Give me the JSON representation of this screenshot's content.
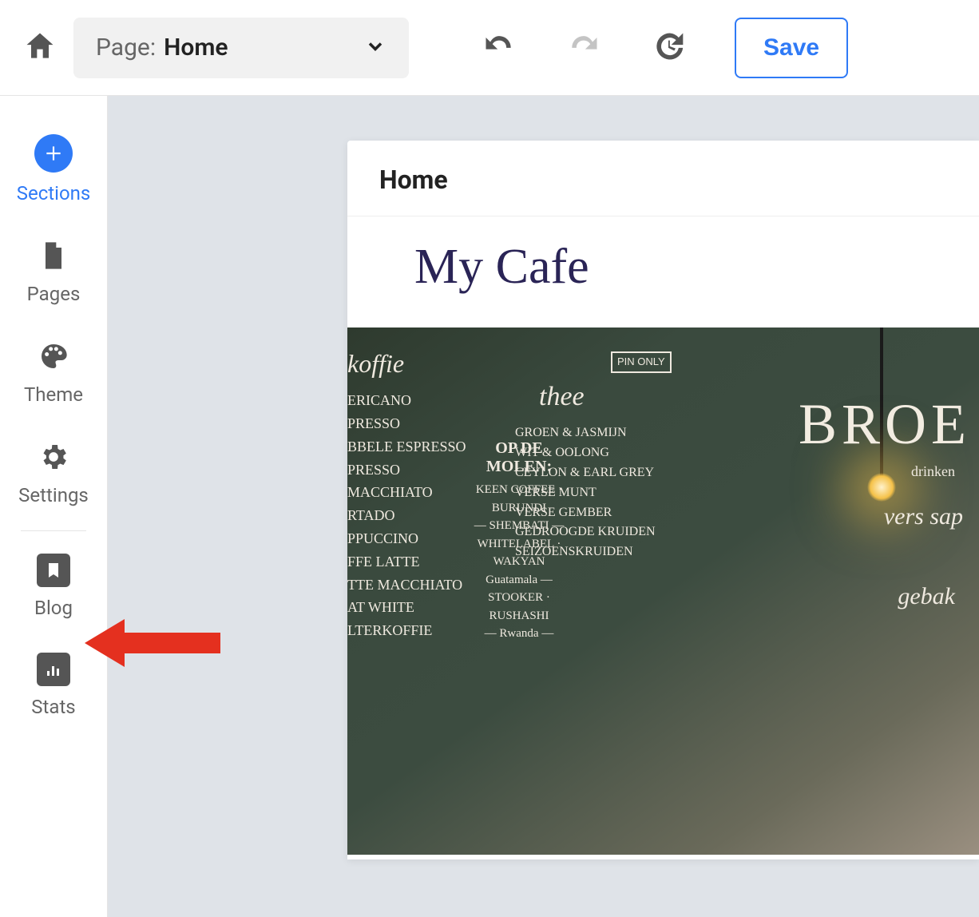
{
  "toolbar": {
    "page_label": "Page:",
    "page_value": "Home",
    "save_label": "Save"
  },
  "sidebar": {
    "items": [
      {
        "label": "Sections"
      },
      {
        "label": "Pages"
      },
      {
        "label": "Theme"
      },
      {
        "label": "Settings"
      },
      {
        "label": "Blog"
      },
      {
        "label": "Stats"
      }
    ]
  },
  "canvas": {
    "breadcrumb": "Home",
    "site_title": "My Cafe",
    "hero": {
      "brand": "BROE",
      "col_left_heading": "koffie",
      "col_left_items": [
        "ERICANO",
        "PRESSO",
        "BBELE ESPRESSO",
        "PRESSO MACCHIATO",
        "RTADO",
        "PPUCCINO",
        "FFE LATTE",
        "TTE MACCHIATO",
        "AT WHITE",
        "LTERKOFFIE"
      ],
      "mid_title": "OP DE MOLEN:",
      "mid_items": [
        "KEEN COFFEE · BURUNDI",
        "— SHEMBATI —",
        "WHITELABEL · WAKYAN",
        "Guatamala —",
        "STOOKER · RUSHASHI",
        "— Rwanda —"
      ],
      "thee_heading": "thee",
      "thee_items": [
        "GROEN  &  JASMIJN",
        "WIT  &  OOLONG",
        "CEYLON  &  EARL GREY",
        "VERSE MUNT",
        "VERSE GEMBER",
        "GEDROOGDE KRUIDEN",
        "SEIZOENSKRUIDEN"
      ],
      "pin_only": "PIN ONLY",
      "gebak_heading": "gebak",
      "right_sub": "drinken",
      "right_heading": "vers sap"
    }
  }
}
